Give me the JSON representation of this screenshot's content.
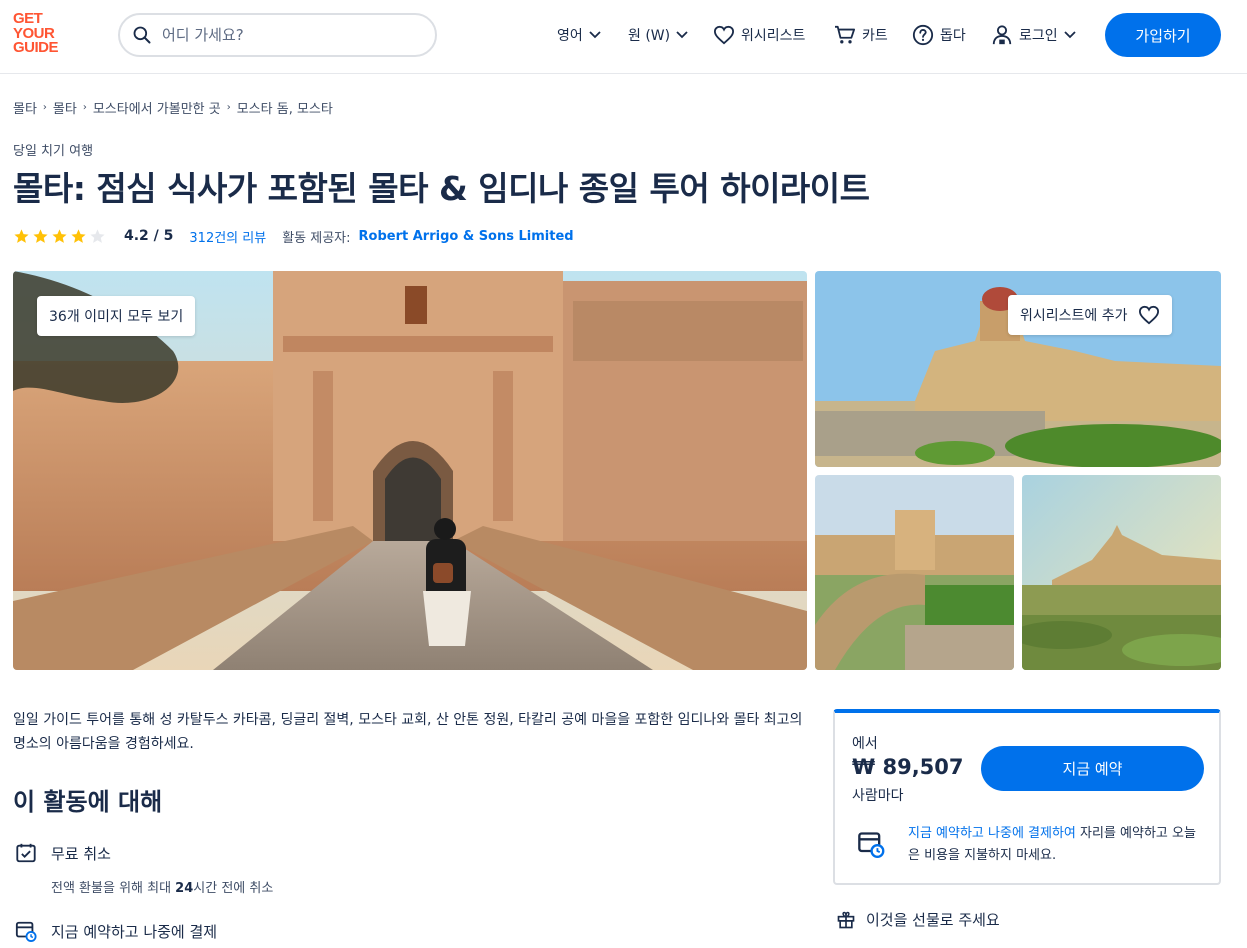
{
  "header": {
    "logo_lines": [
      "GET",
      "YOUR",
      "GUIDE"
    ],
    "search_placeholder": "어디 가세요?",
    "language_label": "영어",
    "currency_label": "원 (W)",
    "wishlist_label": "위시리스트",
    "cart_label": "카트",
    "help_label": "돕다",
    "login_label": "로그인",
    "signup_label": "가입하기"
  },
  "breadcrumb": [
    "몰타",
    "몰타",
    "모스타에서 가볼만한 곳",
    "모스타 돔, 모스타"
  ],
  "activity": {
    "category": "당일 치기 여행",
    "title": "몰타: 점심 식사가 포함된 몰타 & 임디나 종일 투어 하이라이트",
    "rating_value": "4.2 / 5",
    "rating": 4.2,
    "reviews_label": "312건의 리뷰",
    "provider_label": "활동 제공자:",
    "provider_name": "Robert Arrigo & Sons Limited"
  },
  "gallery": {
    "view_all_label": "36개 이미지 모두 보기",
    "wishlist_add_label": "위시리스트에 추가"
  },
  "description": "일일 가이드 투어를 통해 성 카탈두스 카타콤, 딩글리 절벽, 모스타 교회, 산 안톤 정원, 타칼리 공예 마을을 포함한 임디나와 몰타 최고의 명소의 아름다움을 경험하세요.",
  "about": {
    "title": "이 활동에 대해",
    "free_cancel_title": "무료 취소",
    "free_cancel_sub_prefix": "전액 환불을 위해 최대 ",
    "free_cancel_sub_bold": "24",
    "free_cancel_sub_suffix": "시간 전에 취소",
    "reserve_later_title": "지금 예약하고 나중에 결제"
  },
  "booking": {
    "from_label": "에서",
    "price": "₩ 89,507",
    "per_label": "사람마다",
    "book_button": "지금 예약",
    "reserve_link": "지금 예약하고 나중에 결제하여",
    "reserve_text": " 자리를 예약하고 오늘은 비용을 지불하지 마세요."
  },
  "gift_label": "이것을 선물로 주세요",
  "colors": {
    "brand": "#ff5533",
    "primary": "#0071eb",
    "text": "#1a2b49",
    "star": "#ffc107"
  }
}
